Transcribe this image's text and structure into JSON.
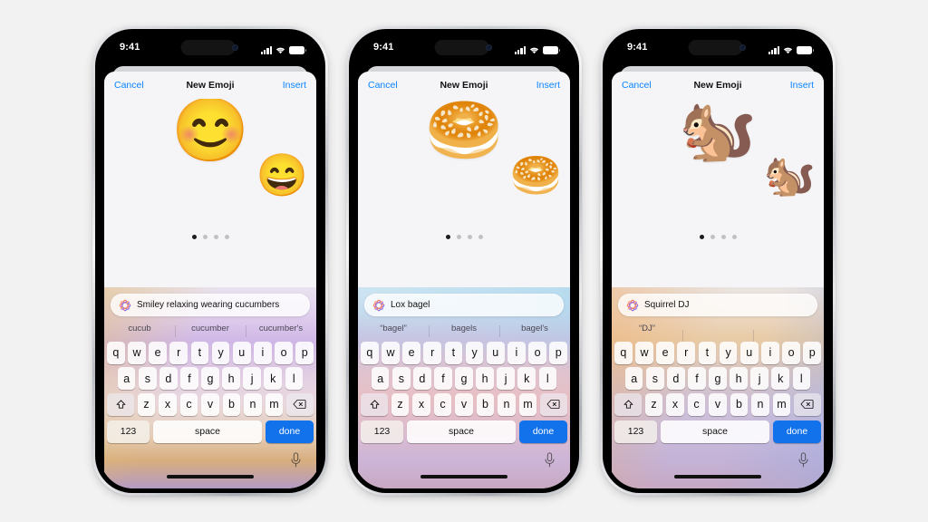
{
  "background_color": "#f2f2f2",
  "accent_color": "#0a84ff",
  "done_key_color": "#1272ec",
  "status_bar": {
    "time": "9:41",
    "signal_icon": "cellular-bars-icon",
    "wifi_icon": "wifi-icon",
    "battery_icon": "battery-full-icon"
  },
  "nav": {
    "cancel_label": "Cancel",
    "title": "New Emoji",
    "insert_label": "Insert"
  },
  "keyboard": {
    "row1": [
      "q",
      "w",
      "e",
      "r",
      "t",
      "y",
      "u",
      "i",
      "o",
      "p"
    ],
    "row2": [
      "a",
      "s",
      "d",
      "f",
      "g",
      "h",
      "j",
      "k",
      "l"
    ],
    "row3": [
      "z",
      "x",
      "c",
      "v",
      "b",
      "n",
      "m"
    ],
    "shift_icon": "shift-up-arrow-icon",
    "backspace_icon": "backspace-delete-icon",
    "numbers_label": "123",
    "space_label": "space",
    "done_label": "done",
    "mic_icon": "microphone-icon"
  },
  "page_dots": {
    "count": 4,
    "active_index": 0
  },
  "phones": [
    {
      "id": "phone-1",
      "prompt_text": "Smiley relaxing wearing cucumbers",
      "prompt_icon": "genmoji-sparkle-ring-icon",
      "emoji_main": "😊",
      "emoji_main_name": "smiley-with-cucumber-eyes",
      "emoji_side": "😄",
      "emoji_side_name": "grinning-face-with-cucumber-eyes",
      "suggestions": [
        "cucub",
        "cucumber",
        "cucumber's"
      ],
      "gradient_name": "purple-tan-gradient"
    },
    {
      "id": "phone-2",
      "prompt_text": "Lox bagel",
      "prompt_icon": "genmoji-sparkle-ring-icon",
      "emoji_main": "🥯",
      "emoji_main_name": "lox-bagel-sandwich",
      "emoji_side": "🥯",
      "emoji_side_name": "bagel-with-salmon",
      "suggestions": [
        "“bagel”",
        "bagels",
        "bagel's"
      ],
      "gradient_name": "blue-pink-gradient"
    },
    {
      "id": "phone-3",
      "prompt_text": "Squirrel DJ",
      "prompt_icon": "genmoji-sparkle-ring-icon",
      "emoji_main": "🐿️",
      "emoji_main_name": "squirrel-dj-with-turntables",
      "emoji_side": "🐿️",
      "emoji_side_name": "squirrel-at-dj-deck",
      "suggestions": [
        "“DJ”",
        "",
        ""
      ],
      "gradient_name": "orange-purple-gradient"
    }
  ]
}
